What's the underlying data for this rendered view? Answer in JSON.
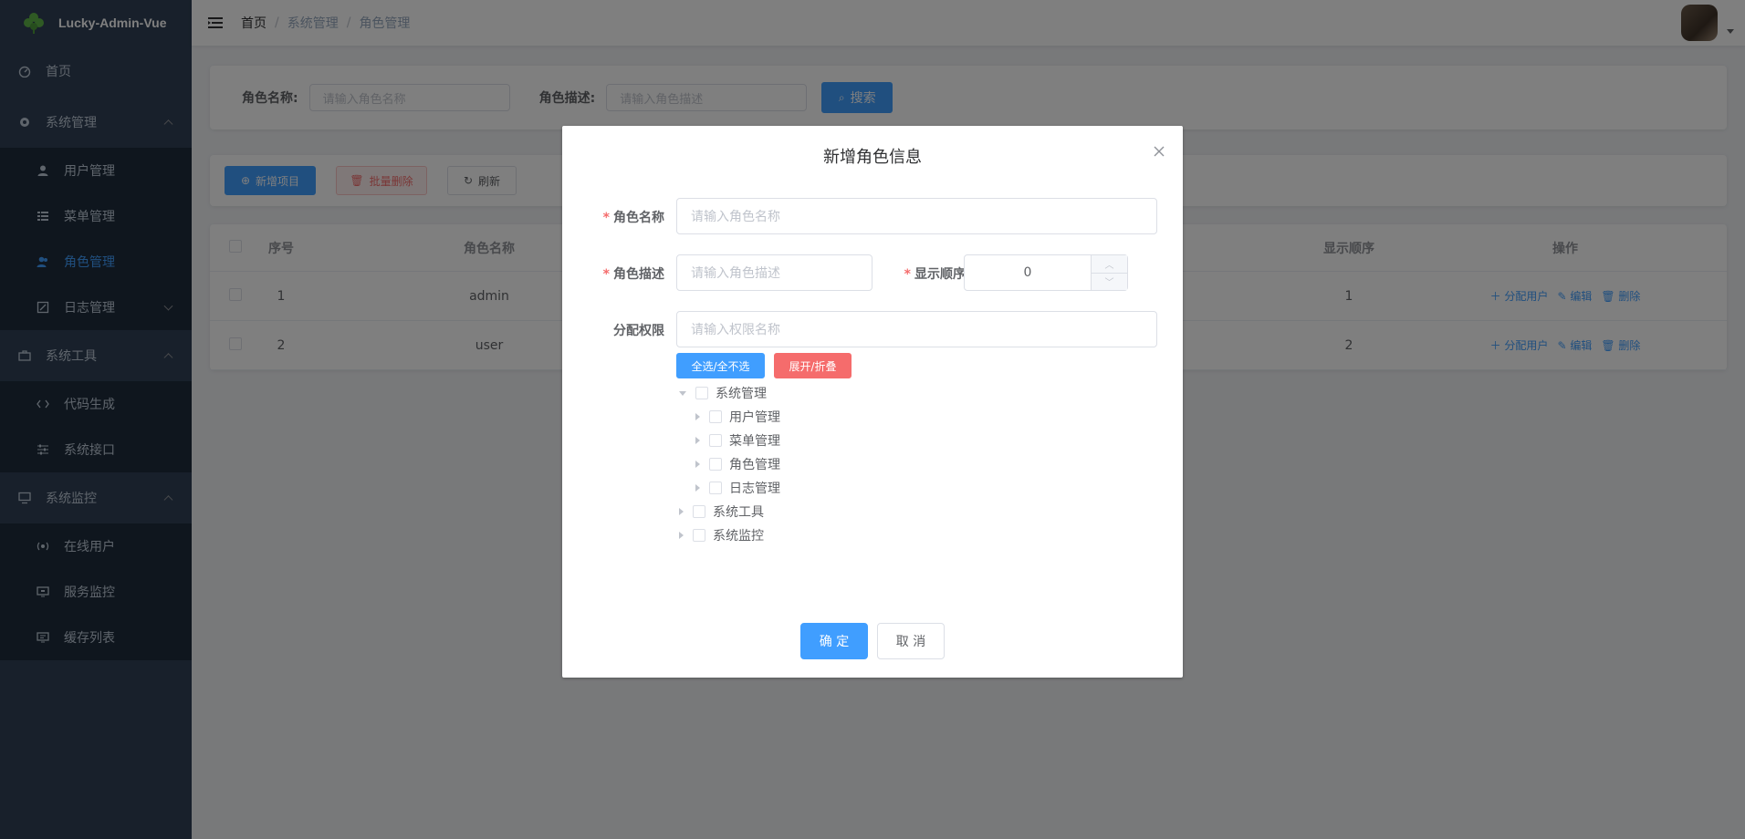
{
  "app": {
    "title": "Lucky-Admin-Vue"
  },
  "sidebar": {
    "items": [
      {
        "label": "首页",
        "icon": "dashboard-icon"
      },
      {
        "label": "系统管理",
        "icon": "gear-icon",
        "children": [
          {
            "label": "用户管理",
            "icon": "user-icon"
          },
          {
            "label": "菜单管理",
            "icon": "list-icon"
          },
          {
            "label": "角色管理",
            "icon": "user-group-icon",
            "active": true
          },
          {
            "label": "日志管理",
            "icon": "edit-icon"
          }
        ]
      },
      {
        "label": "系统工具",
        "icon": "toolbox-icon",
        "children": [
          {
            "label": "代码生成",
            "icon": "code-icon"
          },
          {
            "label": "系统接口",
            "icon": "sliders-icon"
          }
        ]
      },
      {
        "label": "系统监控",
        "icon": "monitor-icon",
        "children": [
          {
            "label": "在线用户",
            "icon": "online-icon"
          },
          {
            "label": "服务监控",
            "icon": "server-icon"
          },
          {
            "label": "缓存列表",
            "icon": "cache-icon"
          }
        ]
      }
    ]
  },
  "breadcrumb": [
    "首页",
    "系统管理",
    "角色管理"
  ],
  "search": {
    "role_name_label": "角色名称:",
    "role_name_placeholder": "请输入角色名称",
    "role_desc_label": "角色描述:",
    "role_desc_placeholder": "请输入角色描述",
    "search_button": "搜索"
  },
  "toolbar": {
    "add": "新增项目",
    "batch_delete": "批量删除",
    "refresh": "刷新"
  },
  "table": {
    "headers": [
      "序号",
      "角色名称",
      "显示顺序",
      "操作"
    ],
    "rows": [
      {
        "index": "1",
        "name": "admin",
        "order": "1"
      },
      {
        "index": "2",
        "name": "user",
        "order": "2"
      }
    ],
    "ops": {
      "assign": "分配用户",
      "edit": "编辑",
      "delete": "删除"
    }
  },
  "dialog": {
    "title": "新增角色信息",
    "role_name_label": "角色名称",
    "role_name_placeholder": "请输入角色名称",
    "role_desc_label": "角色描述",
    "role_desc_placeholder": "请输入角色描述",
    "order_label": "显示顺序",
    "order_value": "0",
    "perm_label": "分配权限",
    "perm_placeholder": "请输入权限名称",
    "select_all": "全选/全不选",
    "expand_collapse": "展开/折叠",
    "tree": [
      {
        "label": "系统管理",
        "expanded": true,
        "level": 0
      },
      {
        "label": "用户管理",
        "level": 1
      },
      {
        "label": "菜单管理",
        "level": 1
      },
      {
        "label": "角色管理",
        "level": 1
      },
      {
        "label": "日志管理",
        "level": 1
      },
      {
        "label": "系统工具",
        "level": 0
      },
      {
        "label": "系统监控",
        "level": 0
      }
    ],
    "confirm": "确 定",
    "cancel": "取 消"
  },
  "colors": {
    "primary": "#409eff",
    "danger": "#f56c6c",
    "sidebar": "#304156"
  }
}
